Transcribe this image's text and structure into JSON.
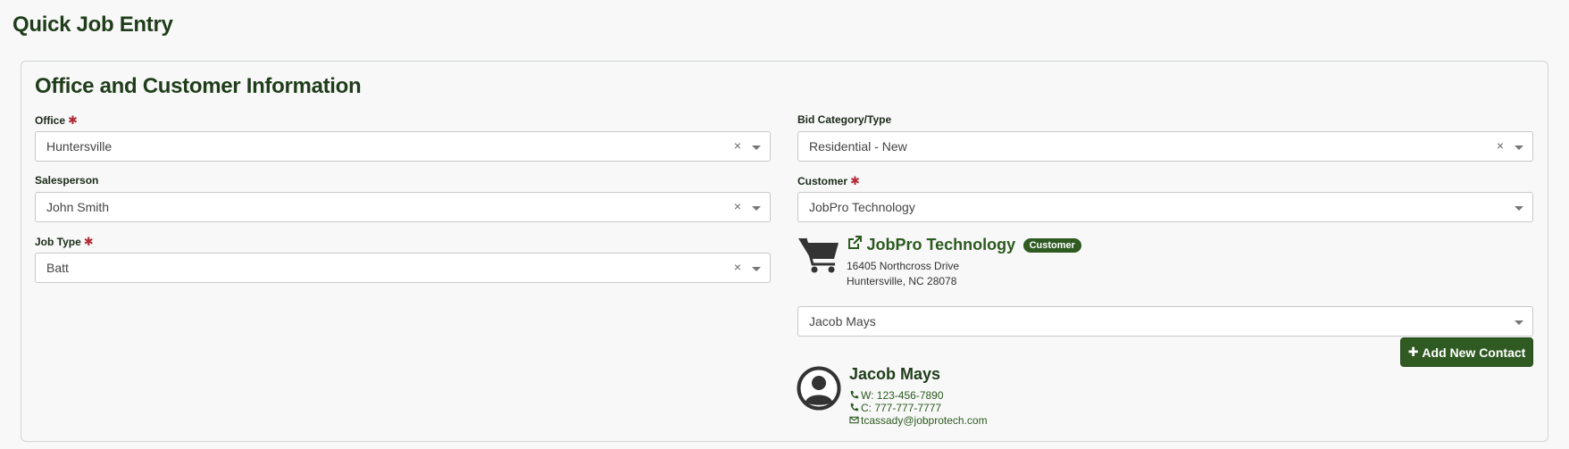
{
  "page": {
    "title": "Quick Job Entry"
  },
  "card": {
    "title": "Office and Customer Information"
  },
  "fields": {
    "office": {
      "label": "Office",
      "required": "✱",
      "value": "Huntersville",
      "clear": "×"
    },
    "salesperson": {
      "label": "Salesperson",
      "value": "John Smith",
      "clear": "×"
    },
    "job_type": {
      "label": "Job Type",
      "required": "✱",
      "value": "Batt",
      "clear": "×"
    },
    "bid_category": {
      "label": "Bid Category/Type",
      "value": "Residential - New",
      "clear": "×"
    },
    "customer": {
      "label": "Customer",
      "required": "✱",
      "value": "JobPro Technology"
    },
    "contact": {
      "value": "Jacob Mays"
    }
  },
  "customer_card": {
    "icon": "shopping-cart-icon",
    "name": "JobPro Technology",
    "badge": "Customer",
    "address_line1": "16405 Northcross Drive",
    "address_line2": "Huntersville, NC 28078"
  },
  "add_contact_button": {
    "label": "Add New Contact",
    "icon": "plus-icon"
  },
  "contact_card": {
    "name": "Jacob Mays",
    "work_phone": "W: 123-456-7890",
    "cell_phone": "C: 777-777-7777",
    "email": "tcassady@jobprotech.com"
  },
  "colors": {
    "brand_green": "#2f5a22",
    "heading": "#1f3d1a",
    "required": "#b02a37"
  }
}
